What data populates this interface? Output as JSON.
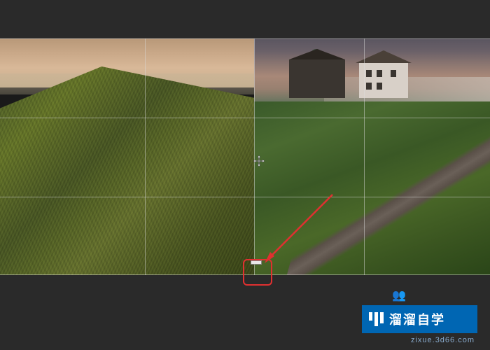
{
  "canvas": {
    "cursor_type": "move",
    "grid_rows": 3,
    "grid_cols": 4
  },
  "annotation": {
    "arrow_color": "#e03030",
    "box_color": "#e03030"
  },
  "watermark": {
    "brand_text": "溜溜自学",
    "url_text": "zixue.3d66.com"
  },
  "icons": {
    "people": "👥"
  }
}
